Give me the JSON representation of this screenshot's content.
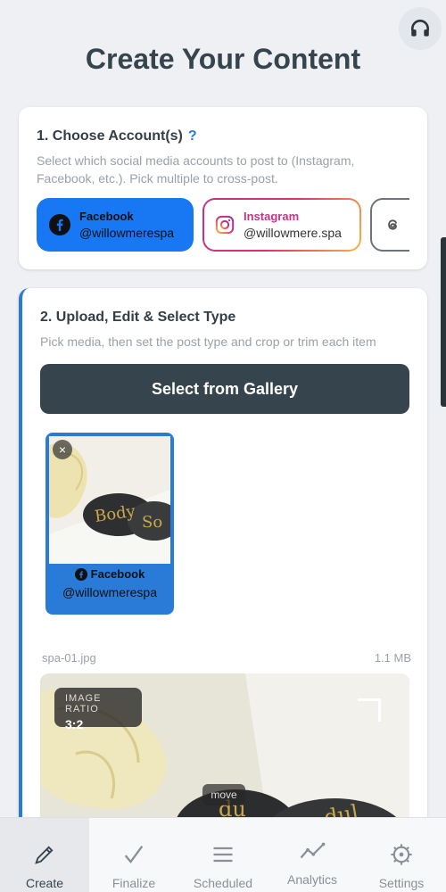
{
  "page": {
    "title": "Create Your Content",
    "support_icon": "headset-icon"
  },
  "accounts_section": {
    "title": "1. Choose Account(s)",
    "help": "?",
    "description": "Select which social media accounts to post to (Instagram, Facebook, etc.). Pick multiple to cross-post.",
    "accounts": [
      {
        "network": "Facebook",
        "handle": "@willowmerespa",
        "selected": true,
        "color": "#1877f2",
        "icon": "facebook-icon"
      },
      {
        "network": "Instagram",
        "handle": "@willowmere.spa",
        "selected": false,
        "color": "#c13584",
        "icon": "instagram-icon"
      },
      {
        "network": "",
        "handle": "",
        "selected": false,
        "color": "#6f747a",
        "icon": "threads-icon"
      }
    ]
  },
  "upload_section": {
    "title": "2. Upload, Edit & Select Type",
    "description": "Pick media, then set the post type and crop or trim each item",
    "gallery_button": "Select from Gallery",
    "media_items": [
      {
        "network": "Facebook",
        "handle": "@willowmerespa",
        "remove": "×"
      }
    ],
    "file_name": "spa-01.jpg",
    "file_size": "1.1 MB",
    "image_ratio_label": "IMAGE RATIO",
    "image_ratio_value": "3:2",
    "move_label": "move"
  },
  "tabs": [
    {
      "label": "Create",
      "icon": "pencil-icon",
      "active": true
    },
    {
      "label": "Finalize",
      "icon": "checkmark-icon",
      "active": false
    },
    {
      "label": "Scheduled",
      "icon": "list-icon",
      "active": false
    },
    {
      "label": "Analytics",
      "icon": "chart-line-icon",
      "active": false
    },
    {
      "label": "Settings",
      "icon": "gear-icon",
      "active": false
    }
  ],
  "colors": {
    "accent": "#2a7ad8",
    "primary_dark": "#36444e",
    "facebook": "#1877f2"
  }
}
